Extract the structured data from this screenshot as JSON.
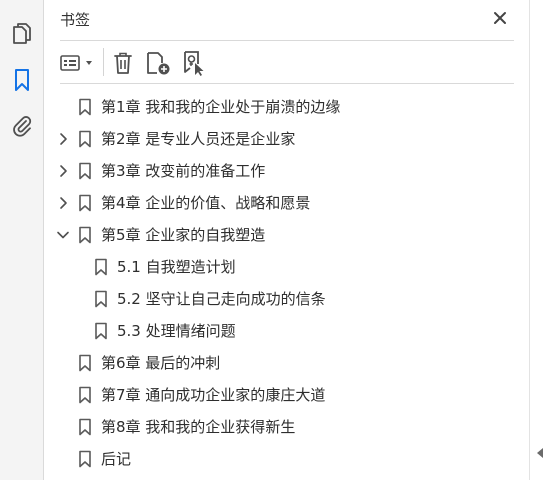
{
  "panel": {
    "title": "书签"
  },
  "left_rail": {
    "items": [
      {
        "name": "pages-icon"
      },
      {
        "name": "bookmark-icon",
        "active": true
      },
      {
        "name": "paperclip-icon"
      }
    ]
  },
  "toolbar": {
    "items": [
      "options-menu-icon",
      "delete-icon",
      "new-bookmark-icon",
      "bookmark-from-selection-icon"
    ]
  },
  "bookmarks": [
    {
      "label": "第1章 我和我的企业处于崩溃的边缘",
      "level": 0,
      "chevron": "none"
    },
    {
      "label": "第2章 是专业人员还是企业家",
      "level": 0,
      "chevron": "collapsed"
    },
    {
      "label": "第3章 改变前的准备工作",
      "level": 0,
      "chevron": "collapsed"
    },
    {
      "label": "第4章 企业的价值、战略和愿景",
      "level": 0,
      "chevron": "collapsed"
    },
    {
      "label": "第5章 企业家的自我塑造",
      "level": 0,
      "chevron": "expanded"
    },
    {
      "label": "5.1 自我塑造计划",
      "level": 1,
      "chevron": "none"
    },
    {
      "label": "5.2 坚守让自己走向成功的信条",
      "level": 1,
      "chevron": "none"
    },
    {
      "label": "5.3 处理情绪问题",
      "level": 1,
      "chevron": "none"
    },
    {
      "label": "第6章 最后的冲刺",
      "level": 0,
      "chevron": "none"
    },
    {
      "label": "第7章 通向成功企业家的康庄大道",
      "level": 0,
      "chevron": "none"
    },
    {
      "label": "第8章 我和我的企业获得新生",
      "level": 0,
      "chevron": "none"
    },
    {
      "label": "后记",
      "level": 0,
      "chevron": "none"
    }
  ],
  "colors": {
    "accent": "#1473e6",
    "icon": "#505050",
    "text": "#2e2e2e"
  }
}
